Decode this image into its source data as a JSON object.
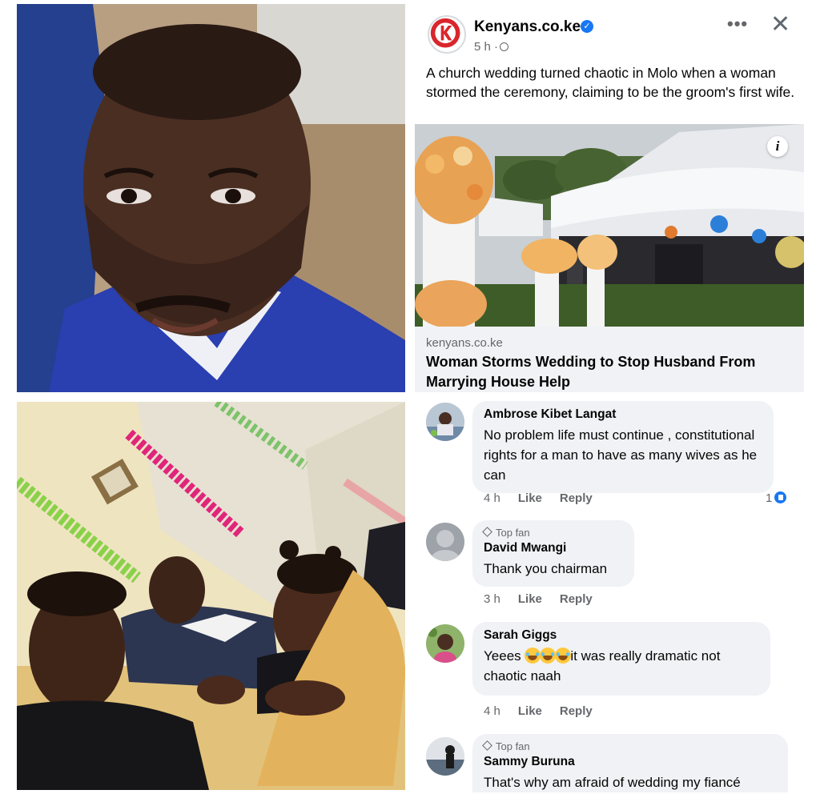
{
  "post": {
    "page_name": "Kenyans.co.ke",
    "time": "5 h ·",
    "text": "A church wedding turned chaotic in Molo when a woman stormed the ceremony, claiming to be the groom's first wife.",
    "more_icon": "more-options-icon",
    "close_icon": "close-icon"
  },
  "link": {
    "domain": "kenyans.co.ke",
    "title": "Woman Storms Wedding to Stop Husband From Marrying House Help"
  },
  "comments": [
    {
      "author": "Ambrose Kibet Langat",
      "text": "No problem life must continue , constitutional rights for a man to have as many wives as he can",
      "time": "4 h",
      "like": "Like",
      "reply": "Reply",
      "reactions": "1"
    },
    {
      "badge": "Top fan",
      "author": "David Mwangi",
      "text": "Thank you chairman",
      "time": "3 h",
      "like": "Like",
      "reply": "Reply"
    },
    {
      "author": "Sarah Giggs",
      "text_before": "Yeees ",
      "text_after": "it was really dramatic not chaotic naah",
      "time": "4 h",
      "like": "Like",
      "reply": "Reply"
    },
    {
      "badge": "Top fan",
      "author": "Sammy Buruna",
      "text": "That's why am afraid of wedding my fiancé"
    }
  ],
  "colors": {
    "brand_blue": "#1877f2",
    "bubble_bg": "#f0f2f5",
    "secondary_text": "#65676b",
    "logo_red": "#d9262c"
  }
}
